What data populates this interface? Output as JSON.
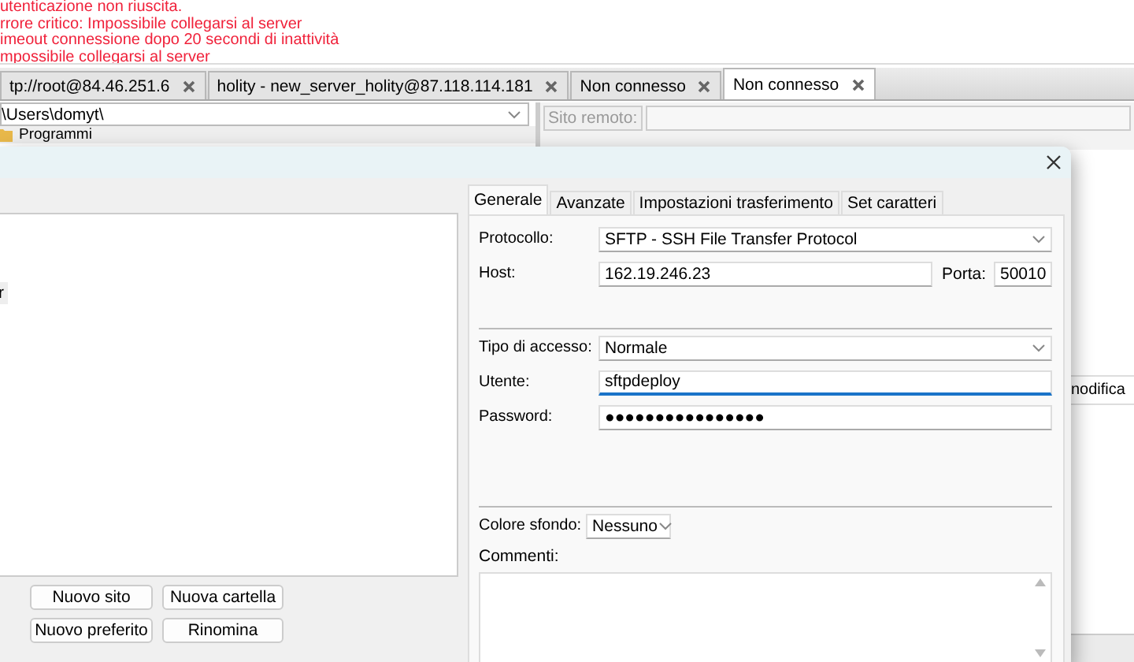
{
  "log": [
    {
      "text": "utenticazione non riuscita."
    },
    {
      "text": "rrore critico: Impossibile collegarsi al server"
    },
    {
      "text": "imeout connessione dopo 20 secondi di inattività"
    },
    {
      "text": "mpossibile collegarsi al server"
    }
  ],
  "tabs": [
    {
      "label": "tp://root@84.46.251.6",
      "selected": false
    },
    {
      "label": "holity - new_server_holity@87.118.114.181",
      "selected": false
    },
    {
      "label": "Non connesso",
      "selected": false
    },
    {
      "label": "Non connesso",
      "selected": true
    }
  ],
  "local_path": {
    "value": "\\Users\\domyt\\"
  },
  "local_tree": [
    {
      "label": "Programmi"
    }
  ],
  "remote_site": {
    "label": "Sito remoto:"
  },
  "remote_columns": [
    "nodifica"
  ],
  "dialog": {
    "tree": [
      {
        "label": "r",
        "selected": true
      }
    ],
    "buttons": [
      [
        "Nuovo sito",
        "Nuova cartella"
      ],
      [
        "Nuovo preferito",
        "Rinomina"
      ]
    ],
    "tabs": [
      {
        "label": "Generale",
        "selected": true
      },
      {
        "label": "Avanzate",
        "selected": false
      },
      {
        "label": "Impostazioni trasferimento",
        "selected": false
      },
      {
        "label": "Set caratteri",
        "selected": false
      }
    ],
    "protocol": {
      "label": "Protocollo:",
      "value": "SFTP - SSH File Transfer Protocol"
    },
    "host": {
      "label": "Host:",
      "value": "162.19.246.23"
    },
    "port": {
      "label": "Porta:",
      "value": "50010"
    },
    "access_type": {
      "label": "Tipo di accesso:",
      "value": "Normale"
    },
    "user": {
      "label": "Utente:",
      "value": "sftpdeploy",
      "focused": true
    },
    "password": {
      "label": "Password:",
      "value": "●●●●●●●●●●●●●●●●"
    },
    "background_color": {
      "label": "Colore sfondo:",
      "value": "Nessuno"
    },
    "comments": {
      "label": "Commenti:"
    }
  }
}
